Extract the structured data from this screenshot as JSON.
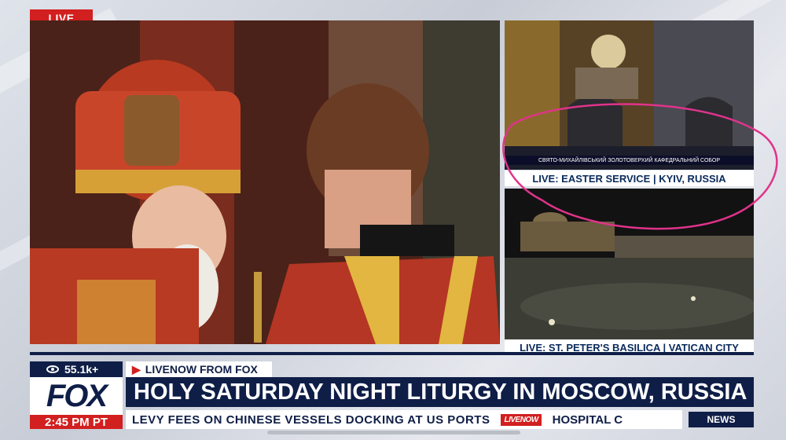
{
  "badge": {
    "live": "LIVE"
  },
  "side_videos": [
    {
      "overlay_text": "СВЯТО-МИХАЙЛІВСЬКИЙ ЗОЛОТОВЕРХИЙ КАФЕДРАЛЬНИЙ СОБОР",
      "caption": "LIVE: EASTER SERVICE | KYIV, RUSSIA"
    },
    {
      "caption": "LIVE: ST. PETER'S BASILICA | VATICAN CITY"
    }
  ],
  "lower_third": {
    "views": "55.1k+",
    "source": "LIVENOW FROM FOX",
    "logo": "FOX",
    "headline": "HOLY SATURDAY NIGHT LITURGY IN MOSCOW, RUSSIA",
    "time": "2:45 PM PT",
    "ticker": "LEVY FEES ON CHINESE VESSELS DOCKING AT US PORTS",
    "ticker_brand": "LIVENOW",
    "ticker_next": "HOSPITAL C",
    "news_tag": "NEWS"
  },
  "annotation": {
    "color": "#e0338a",
    "shape": "ellipse"
  },
  "colors": {
    "navy": "#0f1e47",
    "red": "#d21f1f"
  }
}
